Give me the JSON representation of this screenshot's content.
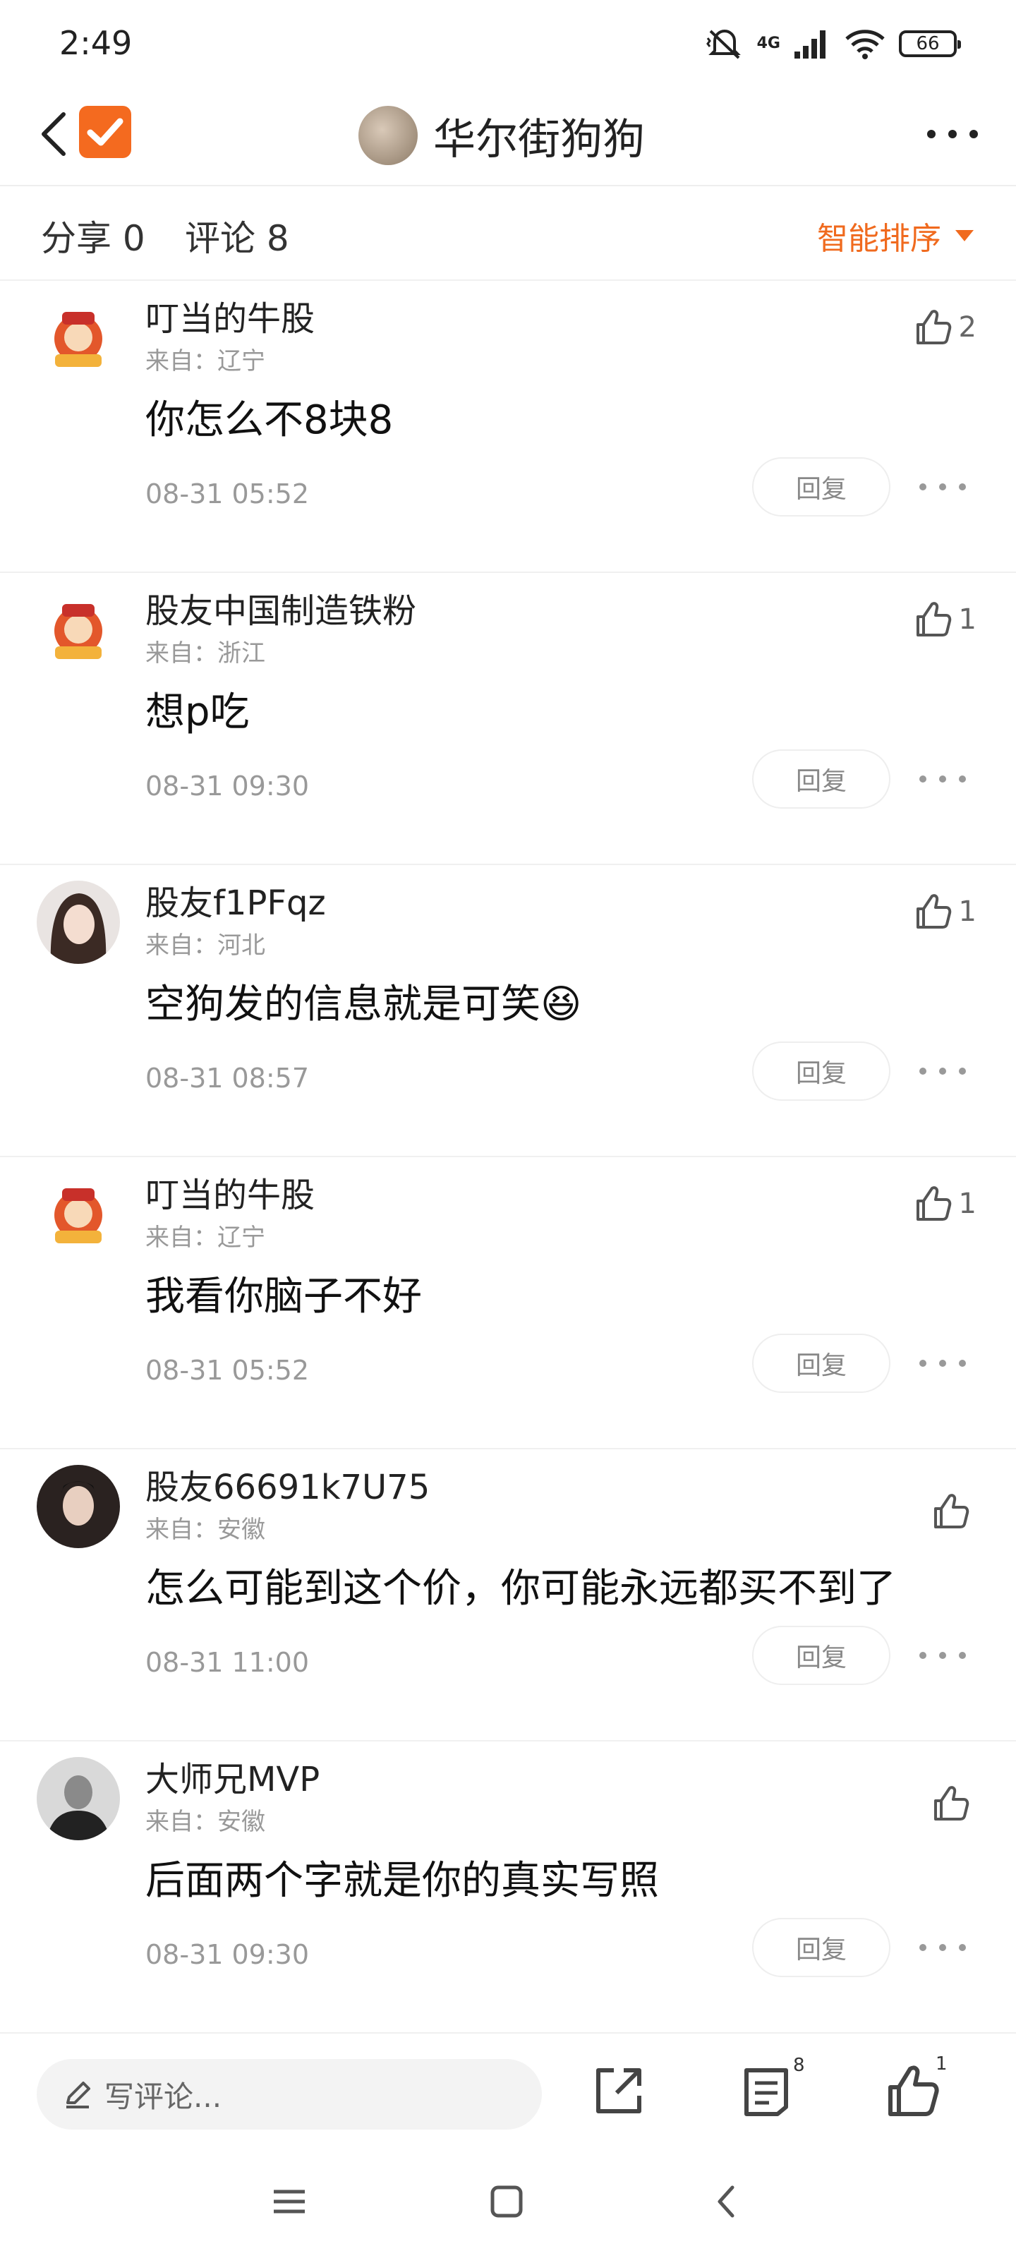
{
  "status_bar": {
    "time": "2:49",
    "network": "4G",
    "battery": "66"
  },
  "header": {
    "title": "华尔街狗狗"
  },
  "counts": {
    "share": "分享 0",
    "comment": "评论 8",
    "sort": "智能排序"
  },
  "colors": {
    "accent": "#f06a1e",
    "secondary_text": "#999999"
  },
  "comments": [
    {
      "name": "叮当的牛股",
      "location": "来自：辽宁",
      "text": "你怎么不8块8",
      "time": "08-31 05:52",
      "likes": "2",
      "reply": "回复"
    },
    {
      "name": "股友中国制造铁粉",
      "location": "来自：浙江",
      "text": "想p吃",
      "time": "08-31 09:30",
      "likes": "1",
      "reply": "回复"
    },
    {
      "name": "股友f1PFqz",
      "location": "来自：河北",
      "text": "空狗发的信息就是可笑😆",
      "time": "08-31 08:57",
      "likes": "1",
      "reply": "回复"
    },
    {
      "name": "叮当的牛股",
      "location": "来自：辽宁",
      "text": "我看你脑子不好",
      "time": "08-31 05:52",
      "likes": "1",
      "reply": "回复"
    },
    {
      "name": "股友66691k7U75",
      "location": "来自：安徽",
      "text": "怎么可能到这个价，你可能永远都买不到了",
      "time": "08-31 11:00",
      "likes": "",
      "reply": "回复"
    },
    {
      "name": "大师兄MVP",
      "location": "来自：安徽",
      "text": "后面两个字就是你的真实写照",
      "time": "08-31 09:30",
      "likes": "",
      "reply": "回复"
    }
  ],
  "bottom_bar": {
    "write_placeholder": "写评论...",
    "comment_count": "8",
    "like_count": "1"
  }
}
